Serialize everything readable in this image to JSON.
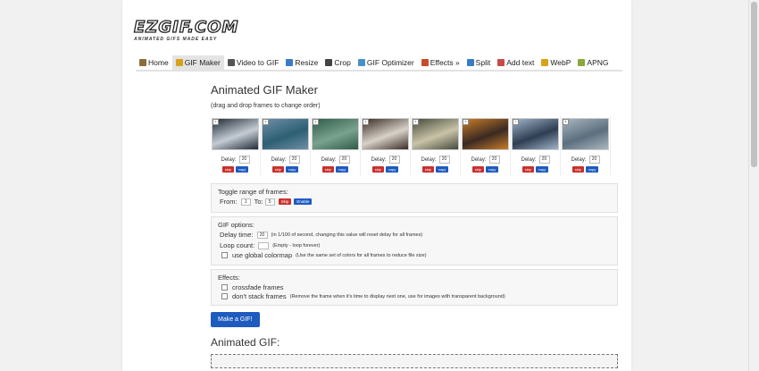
{
  "logo": {
    "text": "EZGIF.COM",
    "tagline": "ANIMATED GIFS MADE EASY"
  },
  "nav": [
    {
      "label": "Home",
      "icon": "home-icon",
      "color": "#8a6d3b",
      "active": false
    },
    {
      "label": "GIF Maker",
      "icon": "gif-maker-icon",
      "color": "#d9a21b",
      "active": true
    },
    {
      "label": "Video to GIF",
      "icon": "video-icon",
      "color": "#555555",
      "active": false
    },
    {
      "label": "Resize",
      "icon": "resize-icon",
      "color": "#3a7bc8",
      "active": false
    },
    {
      "label": "Crop",
      "icon": "crop-icon",
      "color": "#444444",
      "active": false
    },
    {
      "label": "GIF Optimizer",
      "icon": "optimizer-icon",
      "color": "#4a90c8",
      "active": false
    },
    {
      "label": "Effects »",
      "icon": "effects-icon",
      "color": "#c94b2a",
      "active": false
    },
    {
      "label": "Split",
      "icon": "split-icon",
      "color": "#3a7bc8",
      "active": false
    },
    {
      "label": "Add text",
      "icon": "add-text-icon",
      "color": "#c84a4a",
      "active": false
    },
    {
      "label": "WebP",
      "icon": "webp-icon",
      "color": "#d9a21b",
      "active": false
    },
    {
      "label": "APNG",
      "icon": "apng-icon",
      "color": "#8aa83b",
      "active": false
    }
  ],
  "page": {
    "title": "Animated GIF Maker",
    "subtitle": "(drag and drop frames to change order)"
  },
  "frames": [
    {
      "num": "1",
      "delay_label": "Delay:",
      "delay": "20",
      "skip": "skip",
      "copy": "copy",
      "c1": "#1f2a36",
      "c2": "#c5ccd4"
    },
    {
      "num": "2",
      "delay_label": "Delay:",
      "delay": "20",
      "skip": "skip",
      "copy": "copy",
      "c1": "#6f8fa8",
      "c2": "#2d5f73"
    },
    {
      "num": "3",
      "delay_label": "Delay:",
      "delay": "20",
      "skip": "skip",
      "copy": "copy",
      "c1": "#2f5b4a",
      "c2": "#7aa38e"
    },
    {
      "num": "4",
      "delay_label": "Delay:",
      "delay": "20",
      "skip": "skip",
      "copy": "copy",
      "c1": "#3a2b24",
      "c2": "#d8d2c8"
    },
    {
      "num": "5",
      "delay_label": "Delay:",
      "delay": "20",
      "skip": "skip",
      "copy": "copy",
      "c1": "#454a3a",
      "c2": "#c9c3a8"
    },
    {
      "num": "6",
      "delay_label": "Delay:",
      "delay": "20",
      "skip": "skip",
      "copy": "copy",
      "c1": "#c87d2a",
      "c2": "#3b2a22"
    },
    {
      "num": "7",
      "delay_label": "Delay:",
      "delay": "20",
      "skip": "skip",
      "copy": "copy",
      "c1": "#9fb3c8",
      "c2": "#2f3e52"
    },
    {
      "num": "8",
      "delay_label": "Delay:",
      "delay": "20",
      "skip": "skip",
      "copy": "copy",
      "c1": "#aab6c0",
      "c2": "#5c6f7f"
    }
  ],
  "toggle": {
    "header": "Toggle range of frames:",
    "from_label": "From:",
    "from_value": "1",
    "to_label": "To:",
    "to_value": "5",
    "skip": "Skip",
    "enable": "Enable"
  },
  "gif_options": {
    "header": "GIF options:",
    "delay_label": "Delay time:",
    "delay_value": "20",
    "delay_note": "(in 1/100 of second, changing this value will reset delay for all frames)",
    "loop_label": "Loop count:",
    "loop_value": "",
    "loop_note": "(Empty - loop forever)",
    "colormap_label": "use global colormap",
    "colormap_note": "(Use the same set of colors for all frames to reduce file size)"
  },
  "effects": {
    "header": "Effects:",
    "crossfade_label": "crossfade frames",
    "nostack_label": "don't stack frames",
    "nostack_note": "(Remove the frame when it's time to display next one, use for images with transparent background)"
  },
  "make_button": "Make a GIF!",
  "result_title": "Animated GIF:"
}
